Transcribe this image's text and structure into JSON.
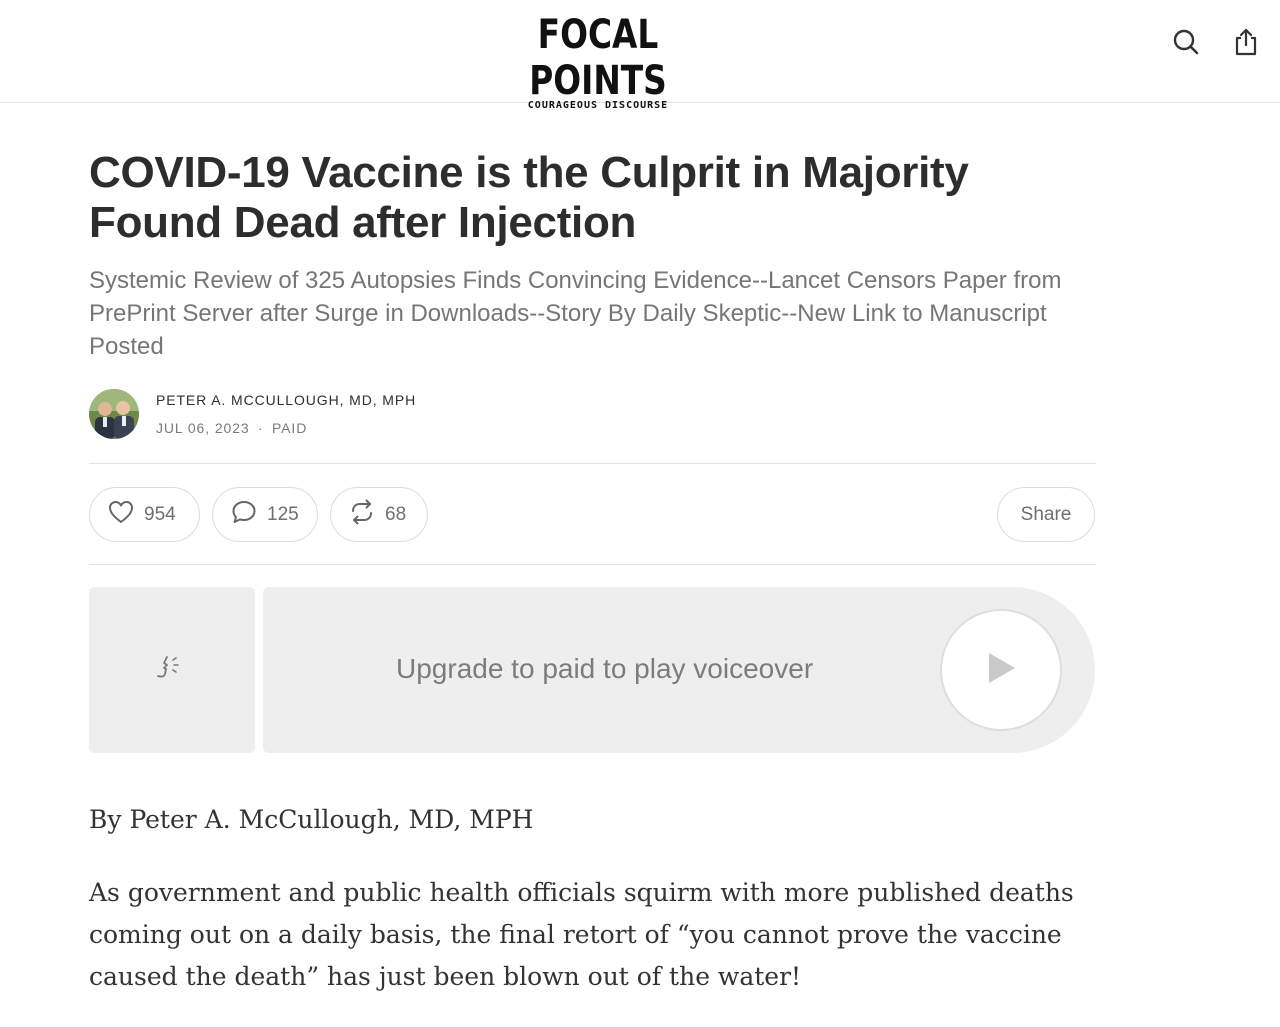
{
  "header": {
    "logo_title": "FOCAL POINTS",
    "logo_tagline": "COURAGEOUS DISCOURSE",
    "search_icon": "search-icon",
    "share_icon": "share-upload-icon"
  },
  "article": {
    "title": "COVID-19 Vaccine is the Culprit in Majority Found Dead after Injection",
    "subtitle": "Systemic Review of 325 Autopsies Finds Convincing Evidence--Lancet Censors Paper from PrePrint Server after Surge in Downloads--Story By Daily Skeptic--New Link to Manuscript Posted",
    "author": "PETER A. MCCULLOUGH, MD, MPH",
    "date": "JUL 06, 2023",
    "separator": "∙",
    "access": "PAID"
  },
  "actions": {
    "likes": "954",
    "comments": "125",
    "restacks": "68",
    "share_label": "Share",
    "like_icon": "heart-icon",
    "comment_icon": "comment-bubble-icon",
    "restack_icon": "restack-icon"
  },
  "voiceover": {
    "label": "Upgrade to paid to play voiceover",
    "voice_icon": "voice-speaking-icon",
    "play_icon": "play-icon"
  },
  "body": {
    "byline": "By Peter A. McCullough, MD, MPH",
    "paragraph1": "As government and public health officials squirm with more published deaths coming out on a daily basis, the final retort of “you cannot prove the vaccine caused the death” has just been blown out of the water!"
  },
  "colors": {
    "text_dark": "#2d2d2d",
    "text_muted": "#767676",
    "divider": "#e2e2e2",
    "voice_bg": "#eeeeee"
  }
}
